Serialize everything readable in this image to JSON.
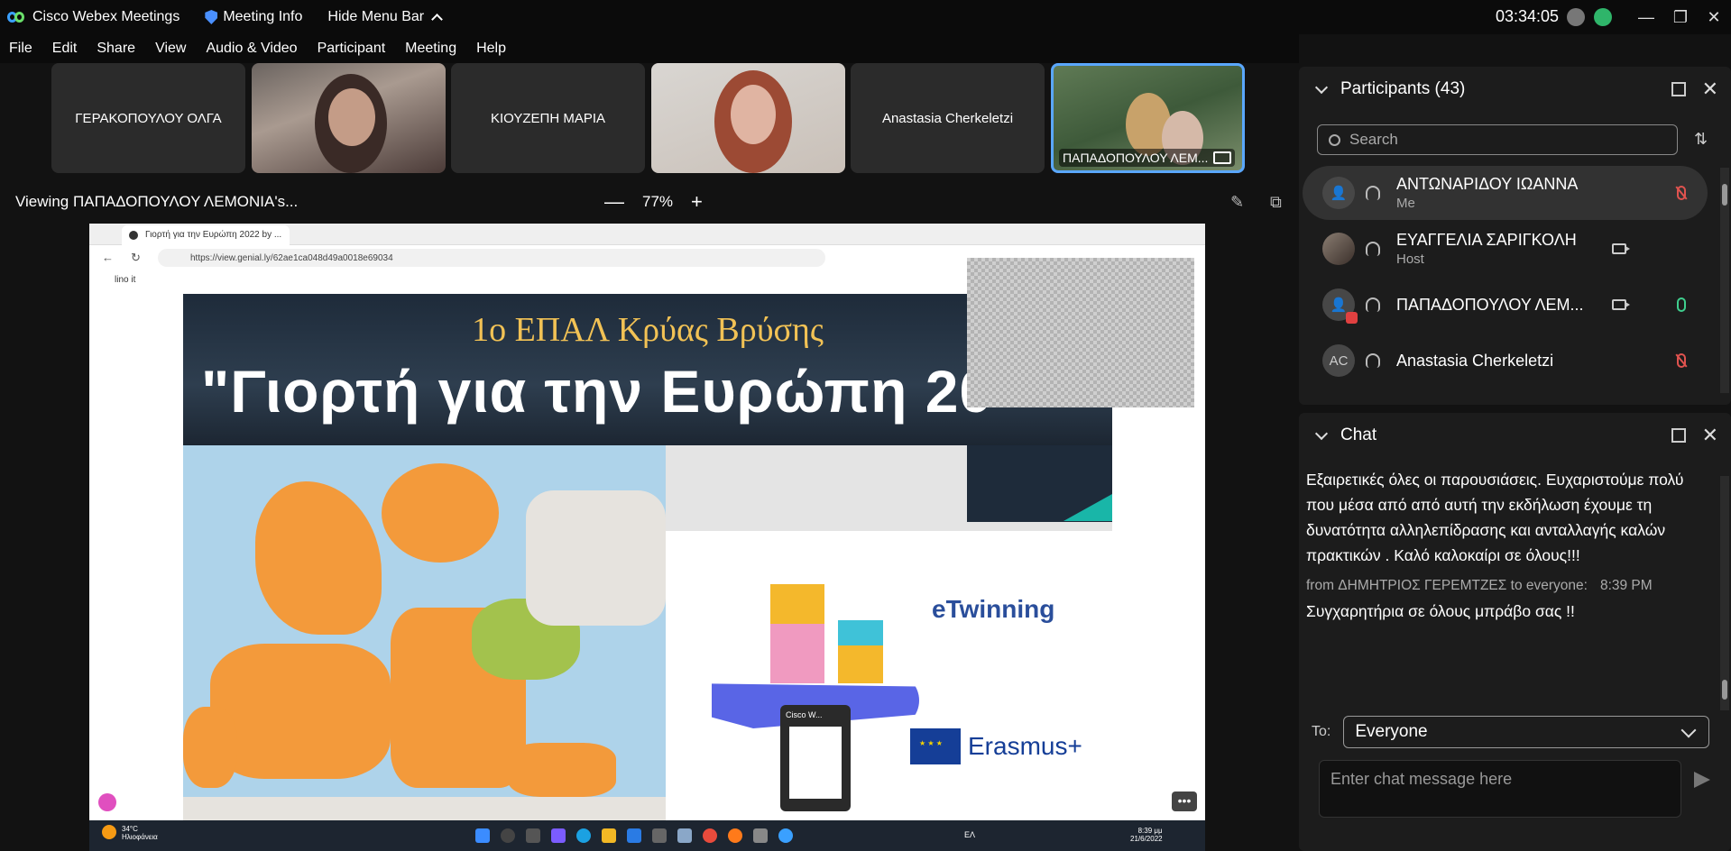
{
  "titlebar": {
    "app_name": "Cisco Webex Meetings",
    "meeting_info": "Meeting Info",
    "hide_menu": "Hide Menu Bar",
    "clock": "03:34:05",
    "window_buttons": [
      "—",
      "❐",
      "✕"
    ]
  },
  "menu": [
    "File",
    "Edit",
    "Share",
    "View",
    "Audio & Video",
    "Participant",
    "Meeting",
    "Help"
  ],
  "video_strip": [
    {
      "name": "ΓΕΡΑΚΟΠΟΥΛΟΥ ΟΛΓΑ",
      "video": false
    },
    {
      "name": "",
      "video": true
    },
    {
      "name": "ΚΙΟΥΖΕΠΗ ΜΑΡΙΑ",
      "video": false
    },
    {
      "name": "",
      "video": true
    },
    {
      "name": "Anastasia Cherkeletzi",
      "video": false
    },
    {
      "name": "ΠΑΠΑΔΟΠΟΥΛΟΥ ΛΕΜ...",
      "video": true,
      "active": true
    }
  ],
  "viewing": {
    "label": "Viewing ΠΑΠΑΔΟΠΟΥΛΟΥ ΛΕΜΟΝΙΑ's...",
    "zoom_minus": "—",
    "zoom": "77%",
    "zoom_plus": "+"
  },
  "shared_screen": {
    "tab_title": "Γιορτή για την Ευρώπη 2022 by ...",
    "url": "https://view.genial.ly/62ae1ca048d49a0018e69034",
    "bookmark": "lino it",
    "slide_title_1": "1ο ΕΠΑΛ Κρύας Βρύσης",
    "slide_title_2": "\"Γιορτή για την Ευρώπη 20",
    "etwinning": "eTwinning",
    "erasmus": "Erasmus+",
    "popup_title": "Cisco W...",
    "weather_temp": "34°C",
    "weather_text": "Ηλιοφάνεια",
    "taskbar_lang": "ΕΛ",
    "taskbar_time": "8:39 μμ",
    "taskbar_date": "21/6/2022"
  },
  "participants": {
    "title": "Participants (43)",
    "search_placeholder": "Search",
    "list": [
      {
        "initials": "",
        "name": "ΑΝΤΩΝΑΡΙΔΟΥ ΙΩΑΝΝΑ",
        "role": "Me",
        "mic": "muted",
        "camera": false
      },
      {
        "initials": "",
        "name": "ΕΥΑΓΓΕΛΙΑ ΣΑΡΙΓΚΟΛΗ",
        "role": "Host",
        "mic": "none",
        "camera": true
      },
      {
        "initials": "",
        "name": "ΠΑΠΑΔΟΠΟΥΛΟΥ ΛΕΜ...",
        "role": "",
        "mic": "on",
        "camera": true
      },
      {
        "initials": "AC",
        "name": "Anastasia Cherkeletzi",
        "role": "",
        "mic": "muted",
        "camera": false
      }
    ]
  },
  "chat": {
    "title": "Chat",
    "messages": [
      {
        "from": "",
        "time": "",
        "text": "Εξαιρετικές όλες οι παρουσιάσεις. Ευχαριστούμε πολύ που μέσα από από αυτή την εκδήλωση έχουμε τη δυνατότητα αλληλεπίδρασης και ανταλλαγής καλών πρακτικών . Καλό καλοκαίρι σε όλους!!!"
      },
      {
        "from": "from ΔΗΜΗΤΡΙΟΣ ΓΕΡΕΜΤΖΕΣ to everyone:",
        "time": "8:39 PM",
        "text": "Συγχαρητήρια σε όλους μπράβο σας !!"
      }
    ],
    "to_label": "To:",
    "to_value": "Everyone",
    "input_placeholder": "Enter chat message here"
  },
  "colors": {
    "accent": "#5aa7ff",
    "muted": "#e0534f",
    "mic_on": "#3fcf8e"
  }
}
